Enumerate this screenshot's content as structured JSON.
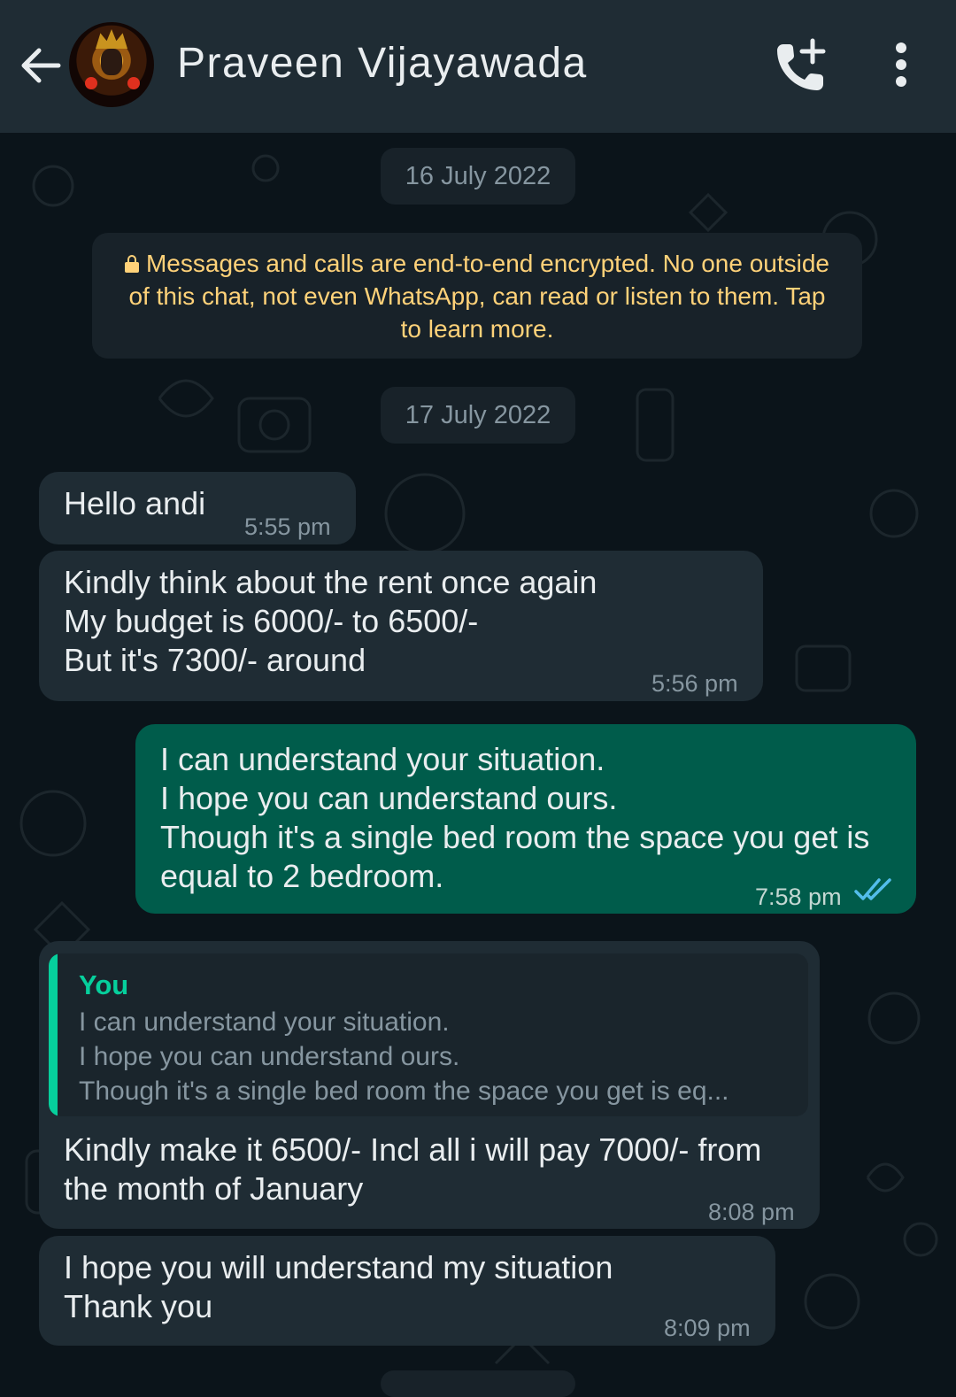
{
  "header": {
    "contact_name": "Praveen Vijayawada",
    "icons": [
      "arrow-back-icon",
      "contact-avatar",
      "add-call-icon",
      "more-vert-icon"
    ]
  },
  "colors": {
    "header_bg": "#1f2c34",
    "chat_bg": "#0b141a",
    "incoming_bubble": "#1f2c34",
    "outgoing_bubble": "#005c4b",
    "encryption_text": "#ffd279",
    "read_ticks": "#53bdeb",
    "quote_accent": "#06cf9c"
  },
  "chat": {
    "date_1": "16 July 2022",
    "encryption_notice": "Messages and calls are end-to-end encrypted. No one outside of this chat, not even WhatsApp, can read or listen to them. Tap to learn more.",
    "date_2": "17 July 2022",
    "messages": [
      {
        "direction": "incoming",
        "text": "Hello andi",
        "time": "5:55 pm"
      },
      {
        "direction": "incoming",
        "text": "Kindly think about the rent once again\nMy budget is 6000/- to 6500/-\nBut it's 7300/- around",
        "time": "5:56 pm"
      },
      {
        "direction": "outgoing",
        "text": "I can understand your situation.\nI hope you can understand ours.\nThough it's a single bed room the space you get is\nequal to 2 bedroom.",
        "time": "7:58 pm",
        "status": "read"
      },
      {
        "direction": "incoming",
        "quote_author": "You",
        "quote_text": "I can understand your situation.\nI hope you can understand ours.\nThough it's a single bed room the space you get is eq...",
        "text": "Kindly make it 6500/- Incl all i will pay 7000/- from\nthe month of January",
        "time": "8:08 pm"
      },
      {
        "direction": "incoming",
        "text": "I hope you will understand my situation\nThank you",
        "time": "8:09 pm"
      }
    ]
  }
}
